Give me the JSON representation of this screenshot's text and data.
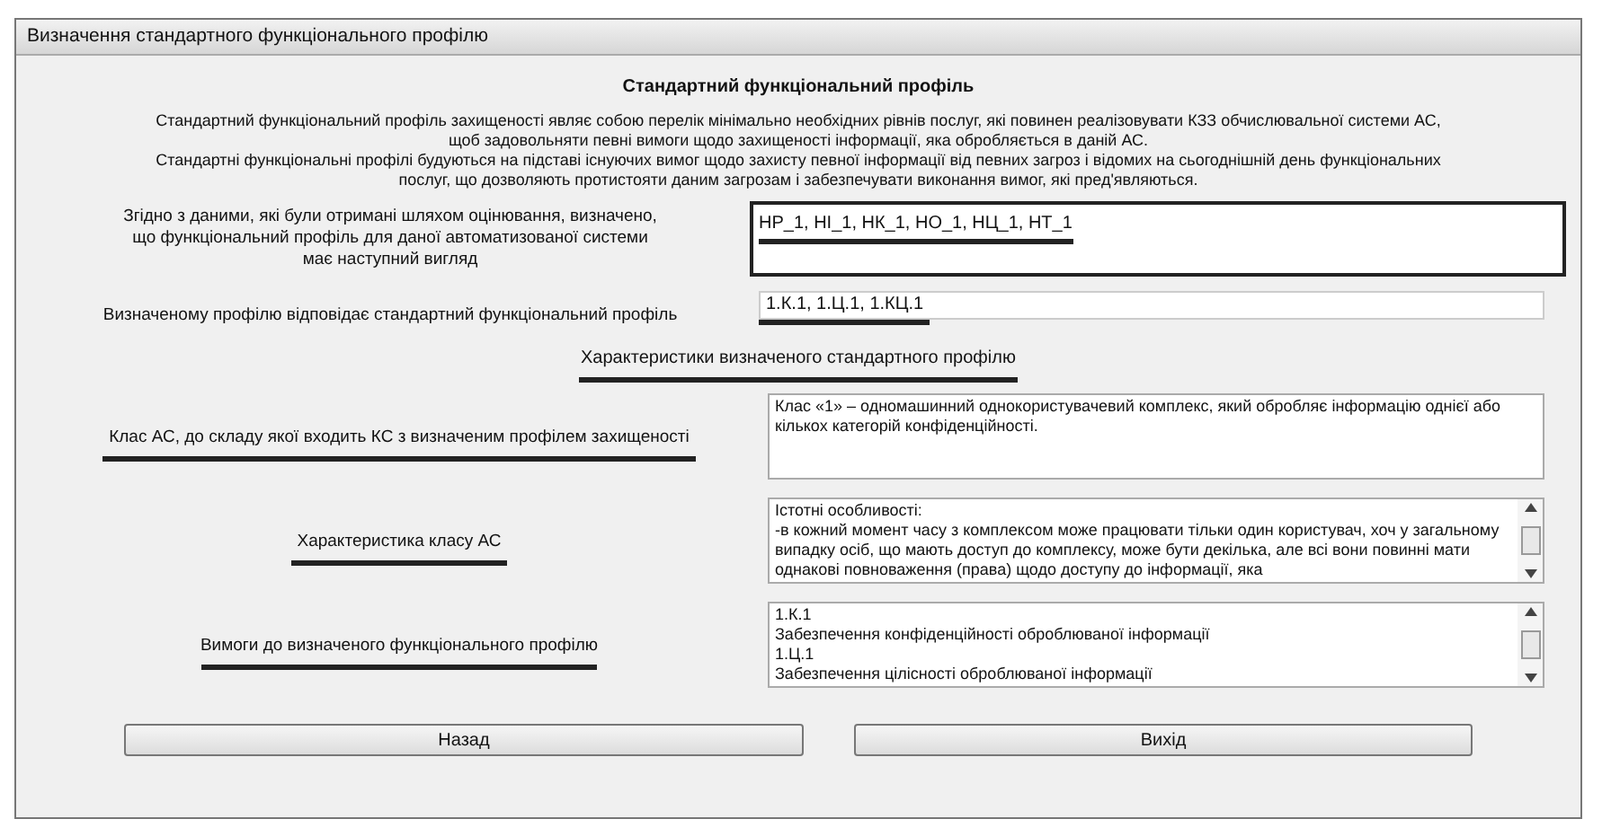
{
  "window": {
    "title": "Визначення стандартного функціонального профілю"
  },
  "heading": "Стандартний функціональний профіль",
  "paragraphs": [
    "Стандартний функціональний профіль захищеності являє собою перелік мінімально необхідних рівнів послуг, які повинен реалізовувати КЗЗ обчислювальної системи АС, щоб задовольняти певні вимоги щодо захищеності інформації, яка обробляється в даній АС.",
    "Стандартні функціональні профілі будуються на підставі існуючих вимог щодо захисту певної інформації від певних загроз і відомих на сьогоднішній день функціональних послуг, що дозволяють протистояти даним загрозам і забезпечувати виконання вимог, які пред'являються."
  ],
  "profile": {
    "label": "Згідно з даними, які були отримані шляхом оцінювання, визначено, що функціональний профіль для даної автоматизованої системи має наступний вигляд",
    "value": "НР_1, НІ_1, НК_1, НО_1, НЦ_1, НТ_1"
  },
  "standard": {
    "label": "Визначеному профілю відповідає стандартний функціональний профіль",
    "value": "1.К.1, 1.Ц.1, 1.КЦ.1"
  },
  "section_heading": "Характеристики визначеного стандартного профілю",
  "details": [
    {
      "label": "Клас АС, до складу якої входить КС з визначеним профілем захищеності",
      "lines": [
        "Клас «1» – одномашинний однокористувачевий комплекс, який обробляє інформацію однієї або кількох категорій конфіденційності."
      ],
      "scrollbar": false
    },
    {
      "label": "Характеристика класу АС",
      "lines": [
        "Істотні особливості:",
        "-в кожний момент часу з комплексом може працювати тільки один користувач, хоч у загальному випадку осіб, що мають доступ до комплексу, може бути декілька, але всі вони повинні мати однакові повноваження (права) щодо доступу до інформації, яка"
      ],
      "scrollbar": true
    },
    {
      "label": "Вимоги до визначеного функціонального профілю",
      "lines": [
        "1.К.1",
        "Забезпечення конфіденційності оброблюваної інформації",
        "1.Ц.1",
        "Забезпечення цілісності оброблюваної інформації"
      ],
      "scrollbar": true
    }
  ],
  "buttons": [
    "Назад",
    "Вихід"
  ]
}
